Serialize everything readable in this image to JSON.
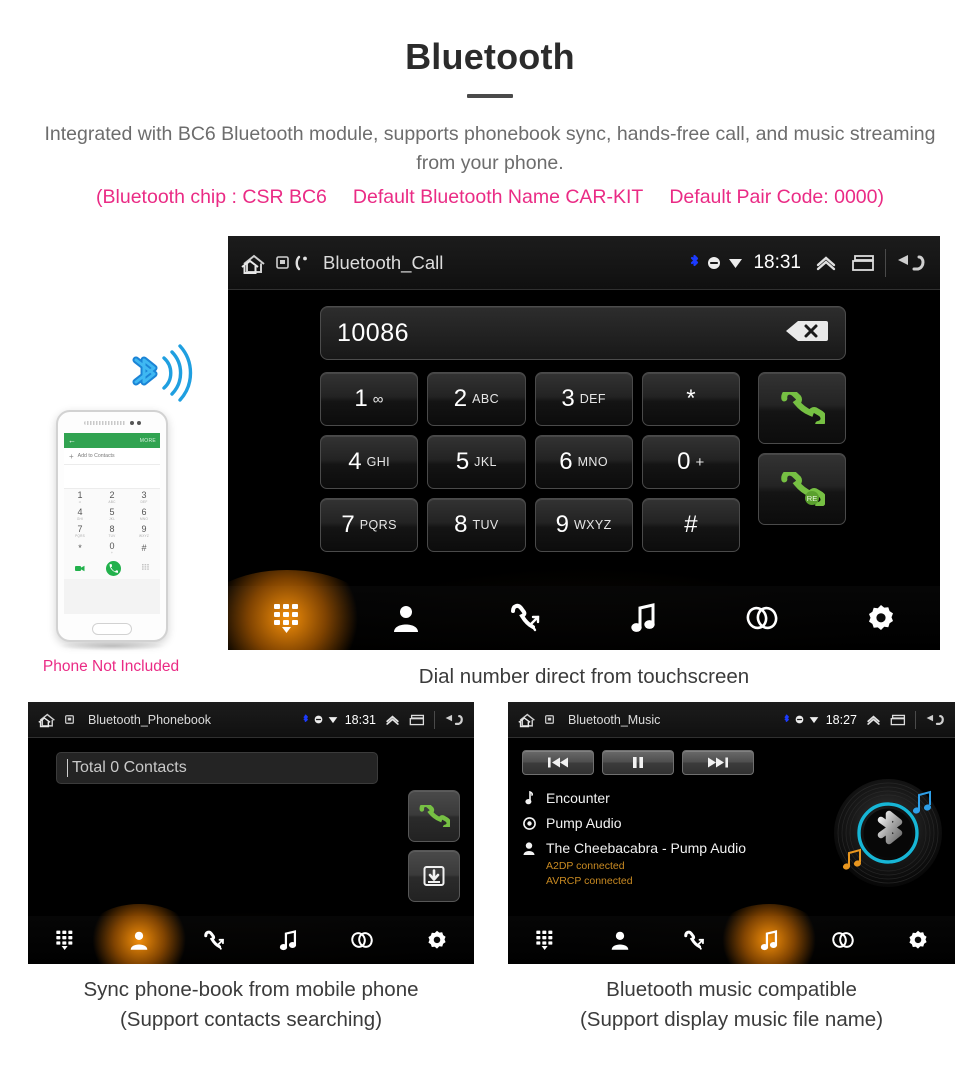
{
  "header": {
    "title": "Bluetooth",
    "subtitle": "Integrated with BC6 Bluetooth module, supports phonebook sync, hands-free call, and music streaming from your phone.",
    "spec_chip": "(Bluetooth chip : CSR BC6",
    "spec_name": "Default Bluetooth Name CAR-KIT",
    "spec_pair": "Default Pair Code: 0000)",
    "accent_color": "#ea2b85",
    "text_color": "#6d6d6d"
  },
  "phone_illustration": {
    "caption": "Phone Not Included",
    "appbar_back": "←",
    "appbar_more": "MORE",
    "add_contacts_label": "Add to Contacts",
    "add_plus": "+",
    "keys": [
      {
        "num": "1",
        "letters": "∞"
      },
      {
        "num": "2",
        "letters": "ABC"
      },
      {
        "num": "3",
        "letters": "DEF"
      },
      {
        "num": "4",
        "letters": "GHI"
      },
      {
        "num": "5",
        "letters": "JKL"
      },
      {
        "num": "6",
        "letters": "MNO"
      },
      {
        "num": "7",
        "letters": "PQRS"
      },
      {
        "num": "8",
        "letters": "TUV"
      },
      {
        "num": "9",
        "letters": "WXYZ"
      },
      {
        "num": "*",
        "letters": ""
      },
      {
        "num": "0",
        "letters": "+"
      },
      {
        "num": "#",
        "letters": ""
      }
    ]
  },
  "main_screen": {
    "statusbar": {
      "title": "Bluetooth_Call",
      "time": "18:31",
      "icons": [
        "home-icon",
        "sdcard-icon",
        "handset-icon",
        "bluetooth-icon",
        "mute-icon",
        "wifi-icon",
        "chevron-up-icon",
        "recents-icon",
        "back-icon"
      ],
      "bluetooth_color": "#1c3bff"
    },
    "dial": {
      "number": "10086",
      "backspace_label": "backspace-icon"
    },
    "keys": [
      {
        "num": "1",
        "sub": "∞",
        "sub_small": true
      },
      {
        "num": "2",
        "sub": "ABC"
      },
      {
        "num": "3",
        "sub": "DEF"
      },
      {
        "num": "*",
        "sub": "",
        "glyph_only": true
      },
      {
        "num": "4",
        "sub": "GHI"
      },
      {
        "num": "5",
        "sub": "JKL"
      },
      {
        "num": "6",
        "sub": "MNO"
      },
      {
        "num": "0",
        "sub": "+",
        "sub_small": true
      },
      {
        "num": "7",
        "sub": "PQRS"
      },
      {
        "num": "8",
        "sub": "TUV"
      },
      {
        "num": "9",
        "sub": "WXYZ"
      },
      {
        "num": "#",
        "sub": "",
        "glyph_only": true
      }
    ],
    "call_buttons": [
      {
        "name": "call-button",
        "label": "call"
      },
      {
        "name": "redial-button",
        "label": "RE"
      }
    ],
    "toolbar": [
      {
        "name": "dialpad",
        "label": "Dialpad",
        "active": true
      },
      {
        "name": "contacts",
        "label": "Contacts",
        "active": false
      },
      {
        "name": "call-history",
        "label": "Call history",
        "active": false
      },
      {
        "name": "music",
        "label": "Music",
        "active": false
      },
      {
        "name": "link",
        "label": "Link",
        "active": false
      },
      {
        "name": "settings",
        "label": "Settings",
        "active": false
      }
    ],
    "caption": "Dial number direct from touchscreen"
  },
  "phonebook_screen": {
    "statusbar": {
      "title": "Bluetooth_Phonebook",
      "time": "18:31"
    },
    "search_placeholder": "Total 0 Contacts",
    "buttons": [
      {
        "name": "call-button",
        "label": "call"
      },
      {
        "name": "download-contacts-button",
        "label": "download"
      }
    ],
    "toolbar": [
      {
        "name": "dialpad",
        "label": "Dialpad",
        "active": false
      },
      {
        "name": "contacts",
        "label": "Contacts",
        "active": true
      },
      {
        "name": "call-history",
        "label": "Call history",
        "active": false
      },
      {
        "name": "music",
        "label": "Music",
        "active": false
      },
      {
        "name": "link",
        "label": "Link",
        "active": false
      },
      {
        "name": "settings",
        "label": "Settings",
        "active": false
      }
    ],
    "caption_line1": "Sync phone-book from mobile phone",
    "caption_line2": "(Support contacts searching)"
  },
  "music_screen": {
    "statusbar": {
      "title": "Bluetooth_Music",
      "time": "18:27"
    },
    "transport": [
      {
        "name": "previous-track-button",
        "glyph": "⏮"
      },
      {
        "name": "pause-button",
        "glyph": "⏸"
      },
      {
        "name": "next-track-button",
        "glyph": "⏭"
      }
    ],
    "track": {
      "title": "Encounter",
      "album": "Pump Audio",
      "artist": "The Cheebacabra - Pump Audio"
    },
    "status_a2dp": "A2DP connected",
    "status_avrcp": "AVRCP connected",
    "status_color": "#c98a22",
    "disc_ring_color": "#17b6d6",
    "toolbar": [
      {
        "name": "dialpad",
        "label": "Dialpad",
        "active": false
      },
      {
        "name": "contacts",
        "label": "Contacts",
        "active": false
      },
      {
        "name": "call-history",
        "label": "Call history",
        "active": false
      },
      {
        "name": "music",
        "label": "Music",
        "active": true
      },
      {
        "name": "link",
        "label": "Link",
        "active": false
      },
      {
        "name": "settings",
        "label": "Settings",
        "active": false
      }
    ],
    "caption_line1": "Bluetooth music compatible",
    "caption_line2": "(Support display music file name)"
  }
}
